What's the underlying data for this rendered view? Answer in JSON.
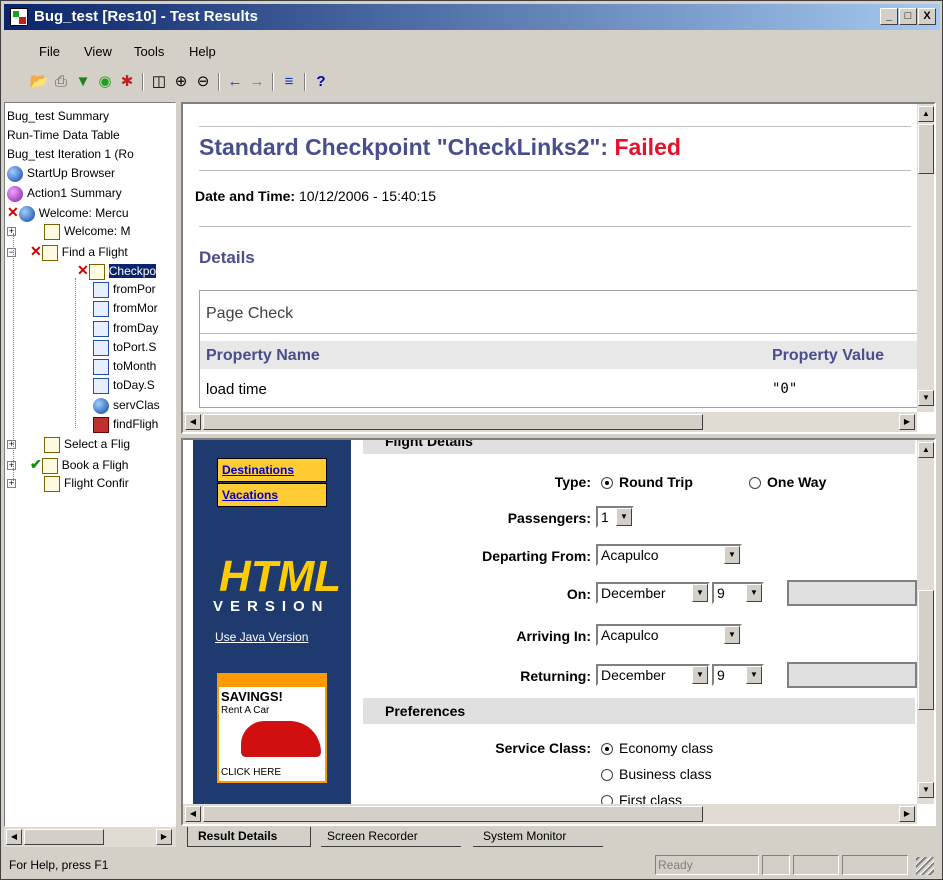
{
  "window": {
    "title": "Bug_test [Res10] - Test Results",
    "min": "_",
    "max": "□",
    "close": "X"
  },
  "menu": [
    "File",
    "View",
    "Tools",
    "Help"
  ],
  "tree": {
    "items": [
      "Bug_test Summary",
      "Run-Time Data Table",
      "Bug_test Iteration 1 (Ro",
      "StartUp Browser",
      "Action1 Summary",
      "Welcome: Mercu",
      "Welcome: M",
      "Find a Flight",
      "Checkpo",
      "fromPor",
      "fromMor",
      "fromDay",
      "toPort.S",
      "toMonth",
      "toDay.S",
      "servClas",
      "findFligh",
      "Select a Flig",
      "Book a Fligh",
      "Flight Confir"
    ]
  },
  "result": {
    "heading_prefix": "Standard Checkpoint \"CheckLinks2\": ",
    "heading_status": "Failed",
    "date_label": "Date and Time:",
    "date_value": "10/12/2006 - 15:40:15",
    "details": "Details",
    "page_check": "Page Check",
    "col_name": "Property Name",
    "col_value": "Property Value",
    "row_name": "load time",
    "row_value": "\"0\""
  },
  "webpage": {
    "section_flight": "Flight Details",
    "nav": [
      "Destinations",
      "Vacations"
    ],
    "logo_big": "HTML",
    "logo_small": "VERSION",
    "java_link": "Use Java Version",
    "ad_title": "SAVINGS!",
    "ad_sub": "Rent A Car",
    "ad_click": "CLICK HERE",
    "type_label": "Type:",
    "round_trip": "Round Trip",
    "one_way": "One Way",
    "passengers_label": "Passengers:",
    "passengers_value": "1",
    "departing_label": "Departing From:",
    "departing_value": "Acapulco",
    "on_label": "On:",
    "on_month": "December",
    "on_day": "9",
    "arriving_label": "Arriving In:",
    "arriving_value": "Acapulco",
    "returning_label": "Returning:",
    "ret_month": "December",
    "ret_day": "9",
    "preferences": "Preferences",
    "service_label": "Service Class:",
    "economy": "Economy class",
    "business": "Business class",
    "first": "First class"
  },
  "tabs": [
    "Result Details",
    "Screen Recorder",
    "System Monitor"
  ],
  "status": {
    "help": "For Help, press F1",
    "ready": "Ready"
  }
}
